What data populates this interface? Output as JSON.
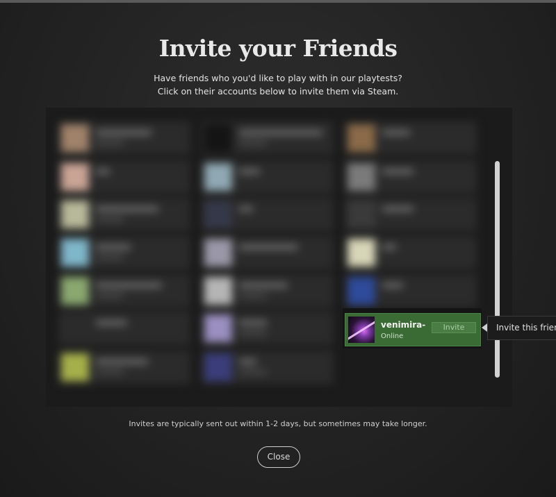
{
  "dialog": {
    "title": "Invite your Friends",
    "subtitle_line1": "Have friends who you'd like to play with in our playtests?",
    "subtitle_line2": "Click on their accounts below to invite them via Steam.",
    "note": "Invites are typically sent out within 1-2 days, but sometimes may take longer.",
    "close_label": "Close"
  },
  "highlighted_friend": {
    "name": "venimira-",
    "status": "Online",
    "invite_label": "Invite",
    "avatar_icon": "purple-character-avatar"
  },
  "tooltip": {
    "text": "Invite this friend"
  },
  "colors": {
    "card_green": "#3b6b35",
    "background": "#232323",
    "text": "#e9e9e9"
  }
}
